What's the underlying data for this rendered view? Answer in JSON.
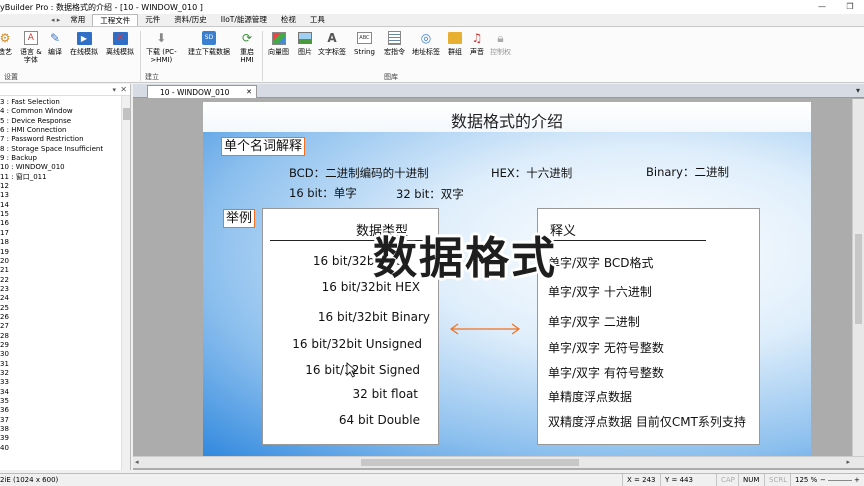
{
  "window": {
    "title": "yBuilder Pro : 数据格式的介绍 - [10 - WINDOW_010 ]",
    "minimize": "—",
    "restore": "❐",
    "close": "✕"
  },
  "menubar": {
    "left_arrows": "◂ ▸",
    "items": [
      "常用",
      "工程文件",
      "元件",
      "资料/历史",
      "IIoT/能源管理",
      "检视",
      "工具"
    ],
    "active_index": 1
  },
  "ribbon": {
    "buttons": [
      {
        "label": "造艺",
        "icon": "wrench-icon"
      },
      {
        "label": "语言 &\n字体",
        "icon": "language-icon"
      },
      {
        "label": "编译",
        "icon": "compile-icon"
      },
      {
        "label": "在线模拟",
        "icon": "online-sim-icon"
      },
      {
        "label": "离线模拟",
        "icon": "offline-sim-icon"
      },
      {
        "label": "下载 (PC-\n>HMI)",
        "icon": "download-icon"
      },
      {
        "label": "建立下载数据",
        "icon": "build-download-icon"
      },
      {
        "label": "重启\nHMI",
        "icon": "restart-icon"
      },
      {
        "label": "向量图",
        "icon": "vector-icon"
      },
      {
        "label": "图片",
        "icon": "picture-icon"
      },
      {
        "label": "文字标签",
        "icon": "text-label-icon"
      },
      {
        "label": "String",
        "icon": "string-icon"
      },
      {
        "label": "宏指令",
        "icon": "macro-icon"
      },
      {
        "label": "地址标签",
        "icon": "address-tag-icon"
      },
      {
        "label": "群组",
        "icon": "group-icon"
      },
      {
        "label": "声音",
        "icon": "sound-icon"
      },
      {
        "label": "控制权",
        "icon": "control-icon"
      }
    ],
    "groups": [
      "设置",
      "建立",
      "图库"
    ]
  },
  "left_panel": {
    "items": [
      "3 : Fast Selection",
      "4 : Common Window",
      "5 : Device Response",
      "6 : HMI Connection",
      "7 : Password Restriction",
      "8 : Storage Space Insufficient",
      "9 : Backup",
      "10 : WINDOW_010",
      "11 : 窗口_011",
      "12",
      "13",
      "14",
      "15",
      "16",
      "17",
      "18",
      "19",
      "20",
      "21",
      "22",
      "23",
      "24",
      "25",
      "26",
      "27",
      "28",
      "29",
      "30",
      "31",
      "32",
      "33",
      "34",
      "35",
      "36",
      "37",
      "38",
      "39",
      "40"
    ]
  },
  "workspace": {
    "tab_label": "10 - WINDOW_010",
    "tab_close": "✕",
    "tabs_dropdown": "▾",
    "screen": {
      "title": "数据格式的介绍",
      "tag1": "单个名词解释",
      "def_line1_a": "BCD：二进制编码的十进制",
      "def_line1_b": "HEX：十六进制",
      "def_line1_c": "Binary：二进制",
      "def_line2_a": "16 bit：单字",
      "def_line2_b": "32 bit：双字",
      "tag2": "举例",
      "left_header": "数据类型",
      "right_header": "释义",
      "left_rows": [
        "16 bit/32bit  BCD",
        "16 bit/32bit  HEX",
        "16 bit/32bit  Binary",
        "16 bit/32bit  Unsigned",
        "16 bit/32bit  Signed",
        "32 bit  float",
        "64 bit  Double"
      ],
      "right_rows": [
        "单字/双字  BCD格式",
        "单字/双字  十六进制",
        "单字/双字  二进制",
        "单字/双字  无符号整数",
        "单字/双字  有符号整数",
        "单精度浮点数据",
        "双精度浮点数据 目前仅CMT系列支持"
      ],
      "overlay": "数据格式"
    }
  },
  "statusbar": {
    "model": "2iE (1024 x 600)",
    "x": "X = 243",
    "y": "Y = 443",
    "cap": "CAP",
    "num": "NUM",
    "scrl": "SCRL",
    "zoom": "125 %",
    "zoom_minus": "−",
    "zoom_plus": "+"
  },
  "colors": {
    "tag_border": "#f07020",
    "arrow": "#f07020",
    "screen_edge": "#2f87de"
  }
}
